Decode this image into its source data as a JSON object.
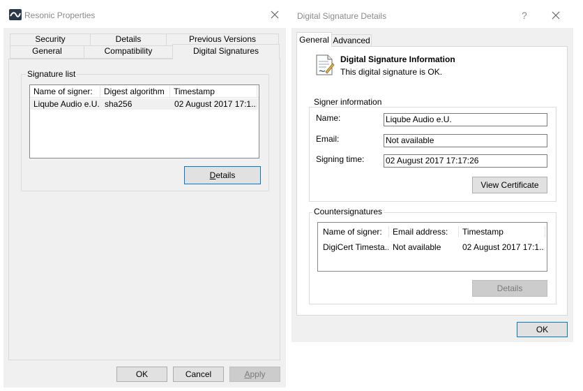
{
  "props": {
    "title": "Resonic Properties",
    "tabs_row1": [
      "Security",
      "Details",
      "Previous Versions"
    ],
    "tabs_row2": [
      "General",
      "Compatibility",
      "Digital Signatures"
    ],
    "sig_group_label": "Signature list",
    "columns": [
      "Name of signer:",
      "Digest algorithm",
      "Timestamp"
    ],
    "rows": [
      {
        "signer": "Liqube Audio e.U.",
        "digest": "sha256",
        "timestamp": "02 August 2017 17:1..."
      }
    ],
    "details_button": {
      "prefix": "",
      "mnemonic": "D",
      "rest": "etails"
    },
    "ok": "OK",
    "cancel": "Cancel",
    "apply": {
      "mnemonic": "A",
      "rest": "pply"
    }
  },
  "dsd": {
    "title": "Digital Signature Details",
    "help": "?",
    "tabs": [
      "General",
      "Advanced"
    ],
    "info_title": "Digital Signature Information",
    "info_status": "This digital signature is OK.",
    "signer_group_label": "Signer information",
    "name_label": "Name:",
    "name_value": "Liqube Audio e.U.",
    "email_label": "Email:",
    "email_value": "Not available",
    "signing_label": "Signing time:",
    "signing_value": "02 August 2017 17:17:26",
    "view_cert": "View Certificate",
    "counter_group_label": "Countersignatures",
    "counter_columns": [
      "Name of signer:",
      "Email address:",
      "Timestamp"
    ],
    "counter_rows": [
      {
        "signer": "DigiCert Timesta...",
        "email": "Not available",
        "timestamp": "02 August 2017 17:1..."
      }
    ],
    "details_disabled": "Details",
    "ok": "OK"
  }
}
